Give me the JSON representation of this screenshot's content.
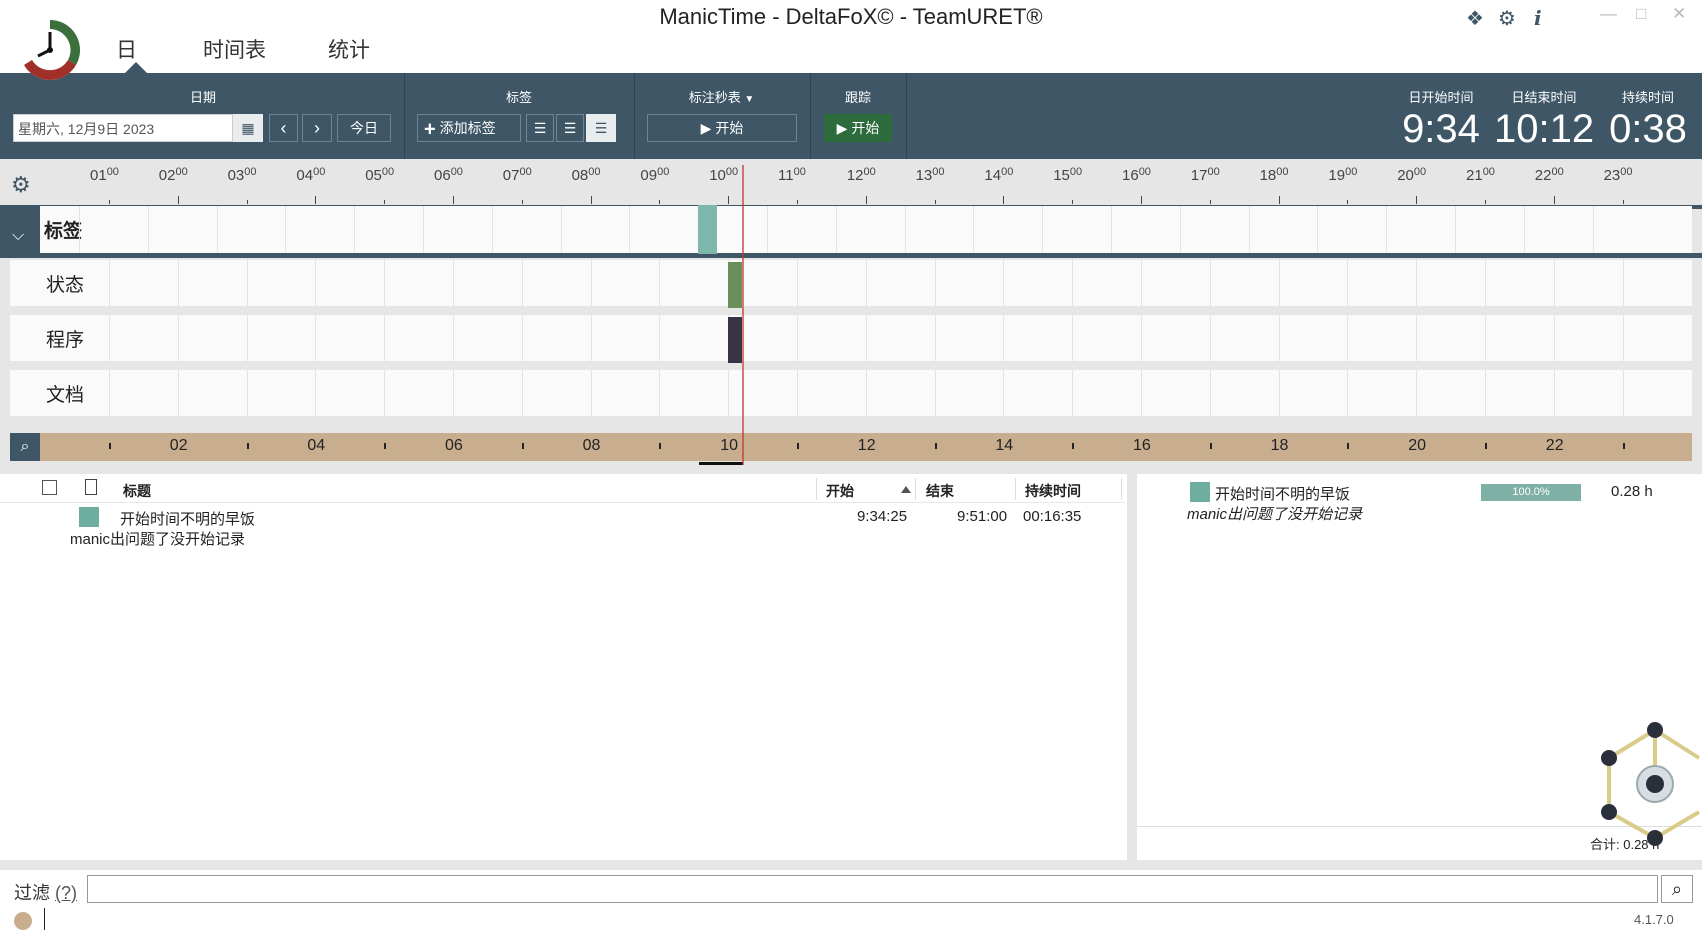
{
  "window": {
    "title": "ManicTime - DeltaFoX© - TeamURET®"
  },
  "main_tabs": [
    {
      "label": "日"
    },
    {
      "label": "时间表"
    },
    {
      "label": "统计"
    }
  ],
  "toolbar": {
    "date_section": {
      "header": "日期",
      "date_value": "星期六, 12月9日 2023",
      "today_label": "今日"
    },
    "tags_section": {
      "header": "标签",
      "add_tag_label": "添加标签"
    },
    "stopwatch_section": {
      "header": "标注秒表",
      "start_label": "开始"
    },
    "tracking_section": {
      "header": "跟踪",
      "start_label": "开始"
    },
    "day_start": {
      "label": "日开始时间",
      "value": "9:34"
    },
    "day_end": {
      "label": "日结束时间",
      "value": "10:12"
    },
    "duration": {
      "label": "持续时间",
      "value": "0:38"
    }
  },
  "timeline": {
    "hour_labels": [
      "01",
      "02",
      "03",
      "04",
      "05",
      "06",
      "07",
      "08",
      "09",
      "10",
      "11",
      "12",
      "13",
      "14",
      "15",
      "16",
      "17",
      "18",
      "19",
      "20",
      "21",
      "22",
      "23"
    ],
    "minute_suffix": "00",
    "rows": [
      {
        "label": "标签"
      },
      {
        "label": "状态"
      },
      {
        "label": "程序"
      },
      {
        "label": "文档"
      }
    ],
    "nav_labels": [
      "02",
      "04",
      "06",
      "08",
      "10",
      "12",
      "14",
      "16",
      "18",
      "20",
      "22"
    ],
    "colors": {
      "tag": "#7eb8ad",
      "status": "#6a8f5a",
      "program": "#3a3344",
      "now_line": "#c0392b"
    }
  },
  "table": {
    "columns": [
      "标题",
      "开始",
      "结束",
      "持续时间"
    ],
    "rows": [
      {
        "title": "开始时间不明的早饭",
        "note": "manic出问题了没开始记录",
        "start": "9:34:25",
        "end": "9:51:00",
        "duration": "00:16:35"
      }
    ]
  },
  "summary": {
    "items": [
      {
        "title": "开始时间不明的早饭",
        "note": "manic出问题了没开始记录",
        "percent": "100.0%",
        "hours": "0.28 h"
      }
    ],
    "total_label": "合计: 0.28 h"
  },
  "filter": {
    "label": "过滤",
    "help": "(?)",
    "value": ""
  },
  "status": {
    "version": "4.1.7.0"
  }
}
